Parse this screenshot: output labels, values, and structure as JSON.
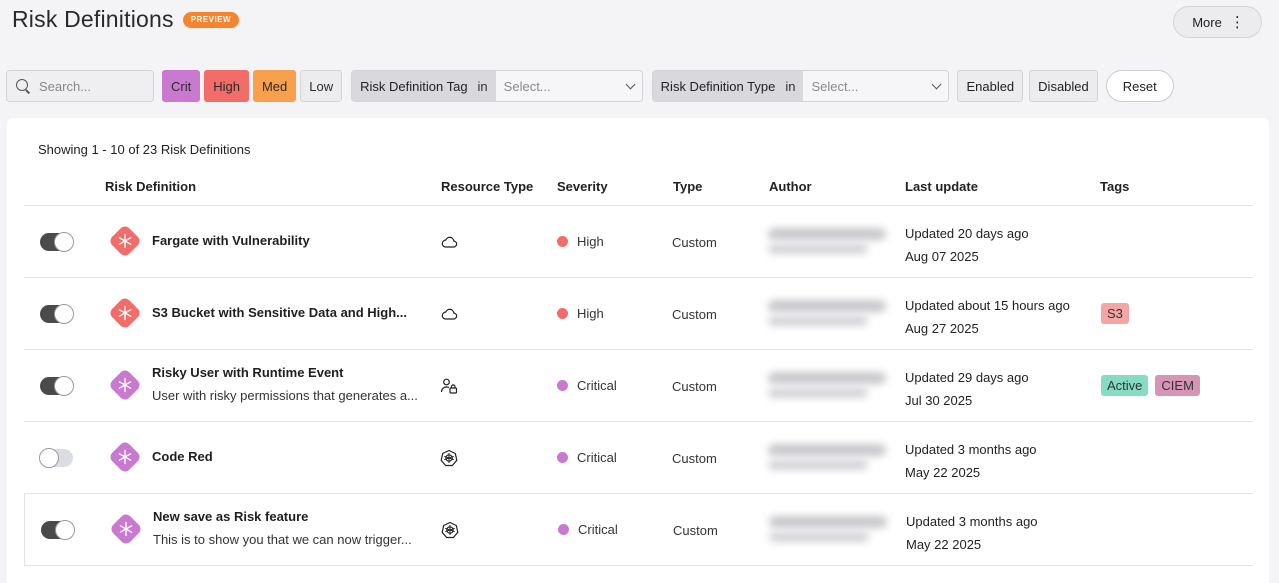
{
  "header": {
    "title": "Risk Definitions",
    "preview_label": "PREVIEW",
    "more_label": "More"
  },
  "filters": {
    "search_placeholder": "Search...",
    "severity": [
      {
        "label": "Crit",
        "color": "#c979d0"
      },
      {
        "label": "High",
        "color": "#f26d6a"
      },
      {
        "label": "Med",
        "color": "#f8a04d"
      },
      {
        "label": "Low",
        "color": "#ececef"
      }
    ],
    "tag_filter": {
      "label": "Risk Definition Tag",
      "operator": "in",
      "placeholder": "Select..."
    },
    "type_filter": {
      "label": "Risk Definition Type",
      "operator": "in",
      "placeholder": "Select..."
    },
    "enabled_label": "Enabled",
    "disabled_label": "Disabled",
    "reset_label": "Reset"
  },
  "table": {
    "showing": "Showing 1 - 10 of 23 Risk Definitions",
    "columns": [
      "Risk Definition",
      "Resource Type",
      "Severity",
      "Type",
      "Author",
      "Last update",
      "Tags"
    ],
    "rows": [
      {
        "enabled": true,
        "icon_color": "#f26d6a",
        "name": "Fargate with Vulnerability",
        "description": "",
        "resource_icon": "cloud-icon",
        "severity": "High",
        "severity_color": "#f26d6a",
        "type": "Custom",
        "updated": "Updated 20 days ago",
        "date": "Aug 07 2025",
        "tags": []
      },
      {
        "enabled": true,
        "icon_color": "#f26d6a",
        "name": "S3 Bucket with Sensitive Data and High...",
        "description": "",
        "resource_icon": "cloud-icon",
        "severity": "High",
        "severity_color": "#f26d6a",
        "type": "Custom",
        "updated": "Updated about 15 hours ago",
        "date": "Aug 27 2025",
        "tags": [
          {
            "label": "S3",
            "color": "#f3a6a4"
          }
        ]
      },
      {
        "enabled": true,
        "icon_color": "#c979d0",
        "name": "Risky User with Runtime Event",
        "description": "User with risky permissions that generates a...",
        "resource_icon": "user-lock-icon",
        "severity": "Critical",
        "severity_color": "#c979d0",
        "type": "Custom",
        "updated": "Updated 29 days ago",
        "date": "Jul 30 2025",
        "tags": [
          {
            "label": "Active",
            "color": "#86dcc3"
          },
          {
            "label": "CIEM",
            "color": "#d694b6"
          }
        ]
      },
      {
        "enabled": false,
        "icon_color": "#c979d0",
        "name": "Code Red",
        "description": "",
        "resource_icon": "kubernetes-icon",
        "severity": "Critical",
        "severity_color": "#c979d0",
        "type": "Custom",
        "updated": "Updated 3 months ago",
        "date": "May 22 2025",
        "tags": []
      },
      {
        "enabled": true,
        "icon_color": "#c979d0",
        "name": "New save as Risk feature",
        "description": "This is to show you that we can now trigger...",
        "resource_icon": "kubernetes-icon",
        "severity": "Critical",
        "severity_color": "#c979d0",
        "type": "Custom",
        "updated": "Updated 3 months ago",
        "date": "May 22 2025",
        "tags": []
      }
    ]
  }
}
